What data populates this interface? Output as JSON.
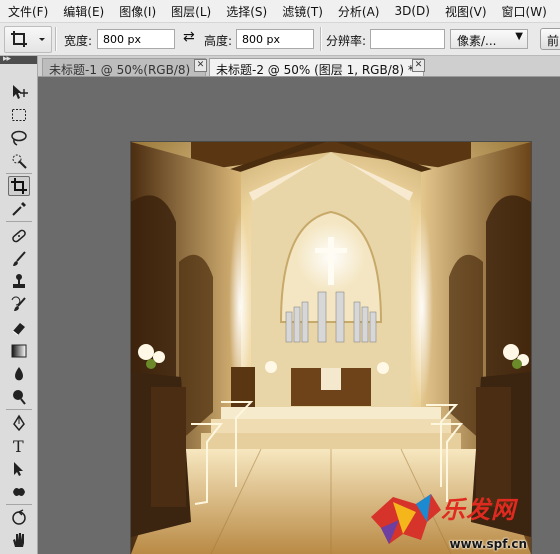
{
  "menu": [
    "文件(F)",
    "编辑(E)",
    "图像(I)",
    "图层(L)",
    "选择(S)",
    "滤镜(T)",
    "分析(A)",
    "3D(D)",
    "视图(V)",
    "窗口(W)"
  ],
  "options": {
    "width_label": "宽度:",
    "width_value": "800 px",
    "height_label": "高度:",
    "height_value": "800 px",
    "resolution_label": "分辨率:",
    "resolution_value": "",
    "unit_select": "像素/...",
    "front_button": "前"
  },
  "tabs": [
    {
      "title": "未标题-1 @ 50%(RGB/8) *",
      "active": false
    },
    {
      "title": "未标题-2 @ 50% (图层 1, RGB/8) *",
      "active": true
    }
  ],
  "toolbox_icons": [
    "move-icon",
    "marquee-icon",
    "lasso-icon",
    "quick-select-icon",
    "crop-icon",
    "eyedropper-icon",
    "healing-brush-icon",
    "brush-icon",
    "clone-stamp-icon",
    "history-brush-icon",
    "eraser-icon",
    "gradient-icon",
    "blur-icon",
    "dodge-icon",
    "pen-icon",
    "type-icon",
    "path-select-icon",
    "custom-shape-icon",
    "rotate-view-icon",
    "hand-icon"
  ],
  "photo": {
    "watermark_logo_text": "乐发网",
    "watermark_url": "www.spf.cn"
  },
  "colors": {
    "menubar_bg": "#f0f0f0",
    "workspace_bg": "#6b6b6b",
    "watermark_red": "#e02a1f"
  }
}
